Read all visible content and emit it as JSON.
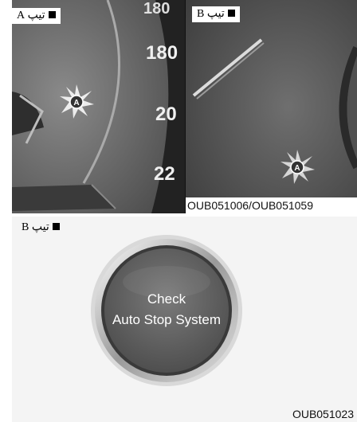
{
  "panels": {
    "a": {
      "label": "تیپ A"
    },
    "b": {
      "label": "تیپ B"
    },
    "c": {
      "label": "تیپ B"
    }
  },
  "speedometer": {
    "numbers": [
      "180",
      "20",
      "22"
    ],
    "top_number": "180"
  },
  "image_codes": {
    "top": "OUB051006/OUB051059",
    "bottom": "OUB051023"
  },
  "button": {
    "line1": "Check",
    "line2": "Auto Stop System"
  },
  "icons": {
    "auto_stop_indicator": "auto-stop-indicator-icon"
  }
}
